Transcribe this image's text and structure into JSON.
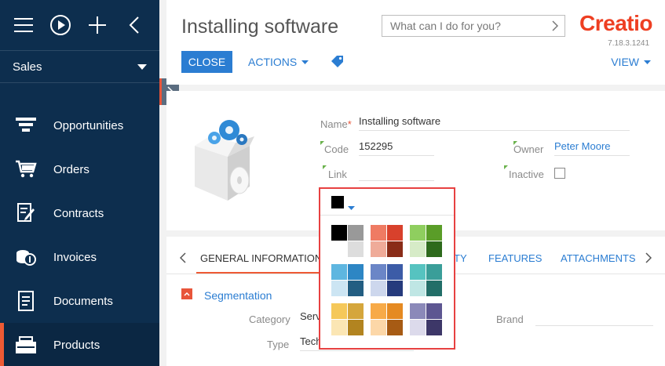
{
  "sidebar": {
    "workspace": "Sales",
    "items": [
      {
        "label": "Opportunities"
      },
      {
        "label": "Orders"
      },
      {
        "label": "Contracts"
      },
      {
        "label": "Invoices"
      },
      {
        "label": "Documents"
      },
      {
        "label": "Products"
      }
    ]
  },
  "header": {
    "title": "Installing software",
    "search_placeholder": "What can I do for you?",
    "logo": "Creatio",
    "version": "7.18.3.1241",
    "close_label": "CLOSE",
    "actions_label": "ACTIONS",
    "view_label": "VIEW"
  },
  "card": {
    "name_label": "Name",
    "name_value": "Installing software",
    "code_label": "Code",
    "code_value": "152295",
    "link_label": "Link",
    "link_value": "",
    "owner_label": "Owner",
    "owner_value": "Peter Moore",
    "inactive_label": "Inactive"
  },
  "tabs": {
    "items": [
      "GENERAL INFORMATION",
      "TY",
      "FEATURES",
      "ATTACHMENTS"
    ],
    "segmentation_title": "Segmentation",
    "category_label": "Category",
    "category_value": "Serv",
    "type_label": "Type",
    "type_value": "Tech",
    "brand_label": "Brand"
  },
  "color_picker": {
    "current_color": "#000000",
    "groups": [
      [
        "#000000",
        "#999999",
        "#ffffff",
        "#dddddd"
      ],
      [
        "#ef7b63",
        "#d8412c",
        "#efab99",
        "#8a2c18"
      ],
      [
        "#8fce5f",
        "#5a9d28",
        "#d6ebc7",
        "#2e6a1c"
      ],
      [
        "#5eb6e0",
        "#2d86c4",
        "#cce5f3",
        "#235e82"
      ],
      [
        "#6b86c7",
        "#3c5ca7",
        "#cdd7ed",
        "#263b7d"
      ],
      [
        "#56c3c0",
        "#3a9e99",
        "#bfe6e4",
        "#226e68"
      ],
      [
        "#f5c85a",
        "#d5a63c",
        "#fbe6b4",
        "#b28420"
      ],
      [
        "#f7aa48",
        "#e58a22",
        "#fcd7a8",
        "#a75b14"
      ],
      [
        "#8b89b9",
        "#5d5691",
        "#dcdaeb",
        "#3d3768"
      ]
    ]
  },
  "colors": {
    "sidebar_bg": "#0d2e4e",
    "accent": "#ee5a34",
    "link": "#2b7dd2",
    "highlight_border": "#e74141"
  }
}
